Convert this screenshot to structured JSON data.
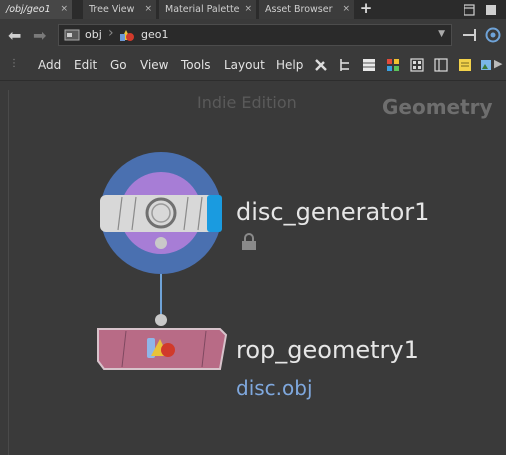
{
  "tabs": [
    {
      "label": "/obj/geo1",
      "close": "×"
    },
    {
      "label": "Tree View",
      "close": "×"
    },
    {
      "label": "Material Palette",
      "close": "×"
    },
    {
      "label": "Asset Browser",
      "close": "×"
    }
  ],
  "add_tab": "+",
  "path": {
    "items": [
      {
        "label": "obj",
        "icon": "obj-context-icon"
      },
      {
        "label": "geo1",
        "icon": "geometry-icon"
      }
    ]
  },
  "menu": [
    "Add",
    "Edit",
    "Go",
    "View",
    "Tools",
    "Layout",
    "Help"
  ],
  "network": {
    "watermark": "Indie Edition",
    "context_label": "Geometry",
    "nodes": [
      {
        "name": "disc_generator1",
        "type": "hda-node",
        "locked": true
      },
      {
        "name": "rop_geometry1",
        "type": "rop-geometry-node",
        "output": "disc.obj"
      }
    ]
  },
  "colors": {
    "background": "#3a3a3a",
    "node_ring": "#4a70b0",
    "node_inner": "#a77dd6",
    "rop_fill": "#b86b86",
    "selected_accent": "#1a9be0",
    "output_text": "#7fa8de"
  }
}
